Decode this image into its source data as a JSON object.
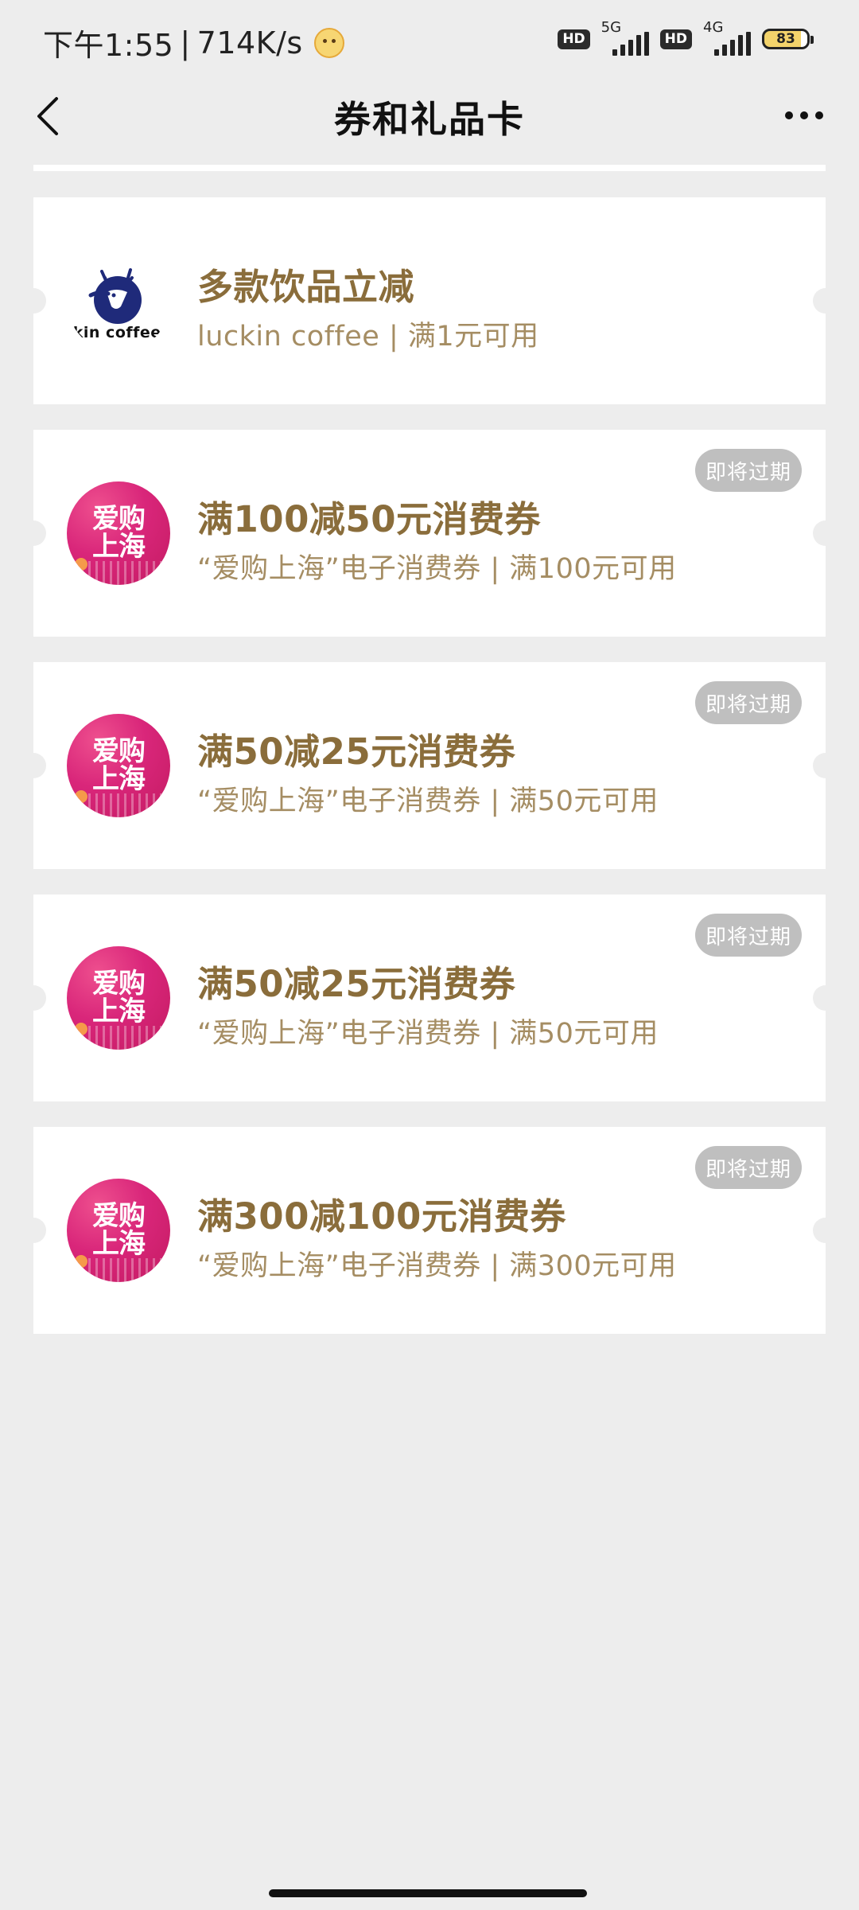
{
  "status_bar": {
    "time": "下午1:55",
    "separator": "|",
    "speed": "714K/s",
    "hd1": "HD",
    "net1": "5G",
    "hd2": "HD",
    "net2": "4G",
    "battery": "83"
  },
  "nav": {
    "title": "券和礼品卡"
  },
  "coupons": [
    {
      "title": "多款饮品立减",
      "desc": "luckin coffee | 满1元可用",
      "logo_text": "ckin coffee",
      "logo": "luckin-deer-icon"
    },
    {
      "title": "满100减50元消费券",
      "desc": "“爱购上海”电子消费券 | 满100元可用",
      "badge": "即将过期",
      "logo_line1": "爱购",
      "logo_line2": "上海"
    },
    {
      "title": "满50减25元消费券",
      "desc": "“爱购上海”电子消费券 | 满50元可用",
      "badge": "即将过期",
      "logo_line1": "爱购",
      "logo_line2": "上海"
    },
    {
      "title": "满50减25元消费券",
      "desc": "“爱购上海”电子消费券 | 满50元可用",
      "badge": "即将过期",
      "logo_line1": "爱购",
      "logo_line2": "上海"
    },
    {
      "title": "满300减100元消费券",
      "desc": "“爱购上海”电子消费券 | 满300元可用",
      "badge": "即将过期",
      "logo_line1": "爱购",
      "logo_line2": "上海"
    }
  ],
  "colors": {
    "background": "#ededed",
    "title_gold": "#8a6d3b",
    "desc_gold": "#a58d63",
    "badge_gray": "#bfbfbf",
    "shop_logo_pink": "#d9267a",
    "luckin_blue": "#1f2a7a"
  }
}
